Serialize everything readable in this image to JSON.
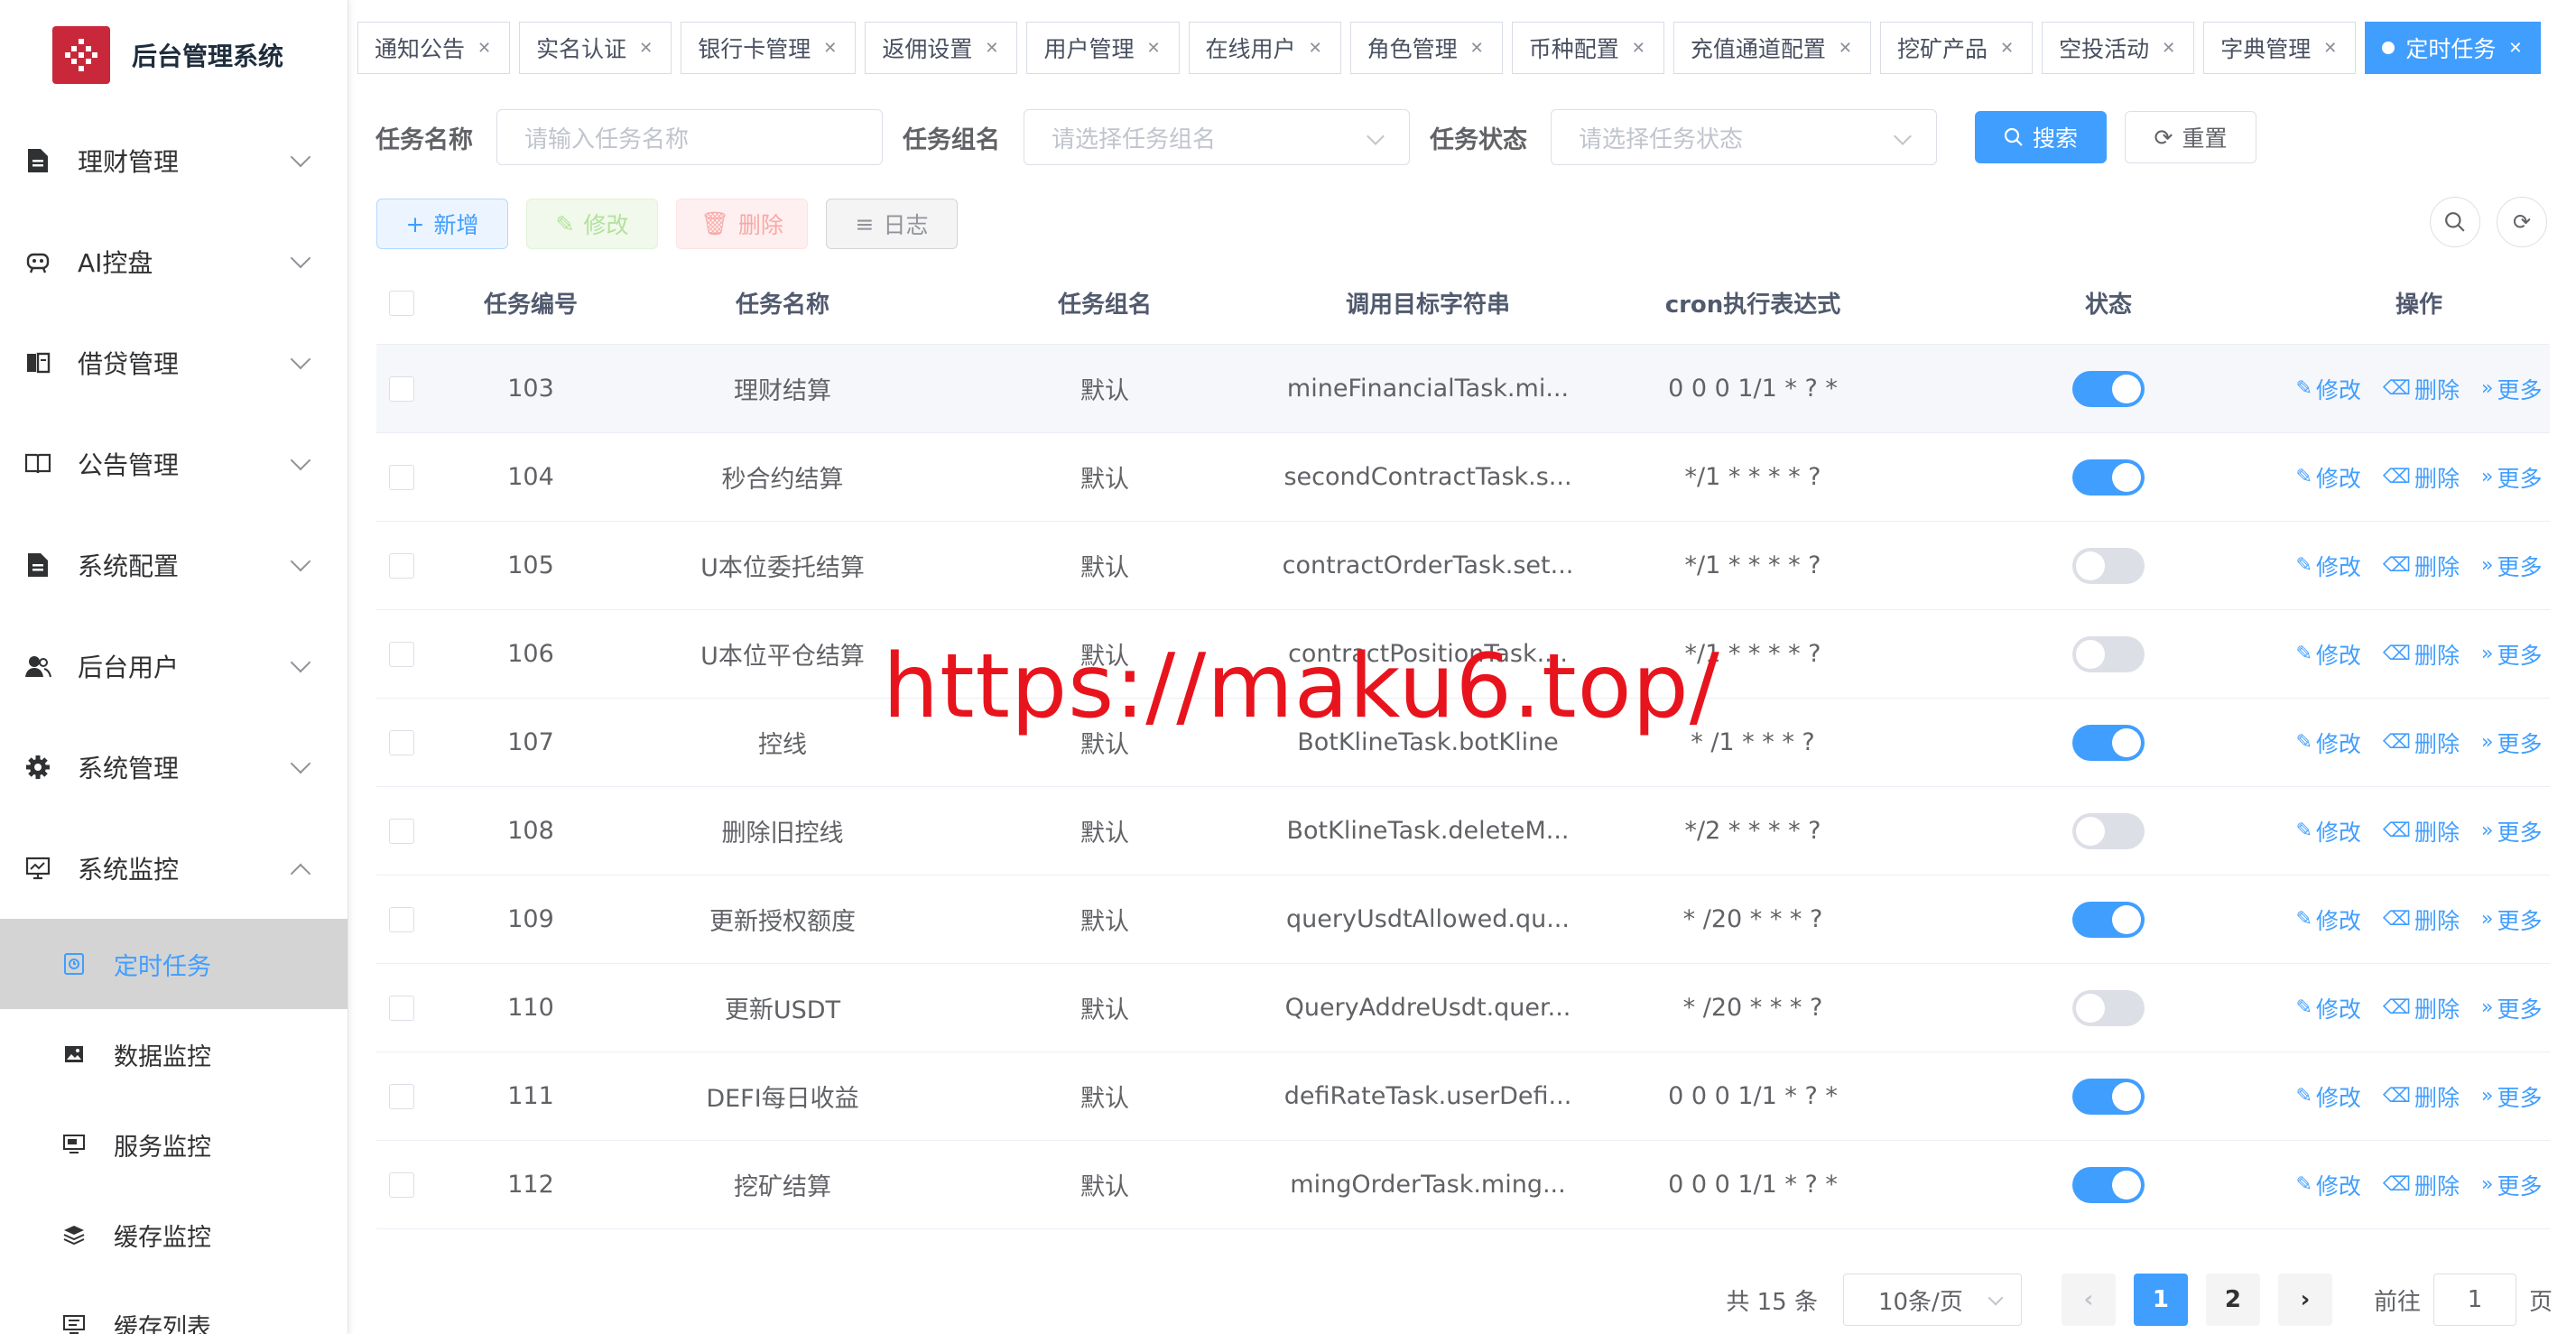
{
  "app": {
    "title": "后台管理系统"
  },
  "sidebar": {
    "menu": [
      {
        "label": "理财管理",
        "icon": "document-icon"
      },
      {
        "label": "AI控盘",
        "icon": "robot-icon"
      },
      {
        "label": "借贷管理",
        "icon": "book-icon"
      },
      {
        "label": "公告管理",
        "icon": "open-book-icon"
      },
      {
        "label": "系统配置",
        "icon": "document-icon"
      },
      {
        "label": "后台用户",
        "icon": "users-icon"
      },
      {
        "label": "系统管理",
        "icon": "gear-icon"
      },
      {
        "label": "系统监控",
        "icon": "monitor-icon"
      }
    ],
    "submenu": [
      {
        "label": "定时任务",
        "icon": "job-icon",
        "active": true
      },
      {
        "label": "数据监控",
        "icon": "image-icon"
      },
      {
        "label": "服务监控",
        "icon": "server-icon"
      },
      {
        "label": "缓存监控",
        "icon": "layers-icon"
      },
      {
        "label": "缓存列表",
        "icon": "list-monitor-icon"
      }
    ]
  },
  "tags": [
    {
      "label": "通知公告"
    },
    {
      "label": "实名认证"
    },
    {
      "label": "银行卡管理"
    },
    {
      "label": "返佣设置"
    },
    {
      "label": "用户管理"
    },
    {
      "label": "在线用户"
    },
    {
      "label": "角色管理"
    },
    {
      "label": "币种配置"
    },
    {
      "label": "充值通道配置"
    },
    {
      "label": "挖矿产品"
    },
    {
      "label": "空投活动"
    },
    {
      "label": "字典管理"
    },
    {
      "label": "定时任务",
      "active": true
    }
  ],
  "filter": {
    "job_name_label": "任务名称",
    "job_name_placeholder": "请输入任务名称",
    "job_group_label": "任务组名",
    "job_group_placeholder": "请选择任务组名",
    "status_label": "任务状态",
    "status_placeholder": "请选择任务状态",
    "search_label": "搜索",
    "reset_label": "重置"
  },
  "toolbar": {
    "add": "新增",
    "edit": "修改",
    "delete": "删除",
    "log": "日志"
  },
  "table": {
    "columns": [
      "任务编号",
      "任务名称",
      "任务组名",
      "调用目标字符串",
      "cron执行表达式",
      "状态",
      "操作"
    ],
    "ops": {
      "edit": "修改",
      "delete": "删除",
      "more": "更多"
    },
    "rows": [
      {
        "id": "103",
        "name": "理财结算",
        "group": "默认",
        "target": "mineFinancialTask.mi...",
        "cron": "0 0 0 1/1 * ? *",
        "enabled": true
      },
      {
        "id": "104",
        "name": "秒合约结算",
        "group": "默认",
        "target": "secondContractTask.s...",
        "cron": "*/1 * * * * ?",
        "enabled": true
      },
      {
        "id": "105",
        "name": "U本位委托结算",
        "group": "默认",
        "target": "contractOrderTask.set...",
        "cron": "*/1 * * * * ?",
        "enabled": false
      },
      {
        "id": "106",
        "name": "U本位平仓结算",
        "group": "默认",
        "target": "contractPositionTask....",
        "cron": "*/1 * * * * ?",
        "enabled": false
      },
      {
        "id": "107",
        "name": "控线",
        "group": "默认",
        "target": "BotKlineTask.botKline",
        "cron": "* /1 * * * ?",
        "enabled": true
      },
      {
        "id": "108",
        "name": "删除旧控线",
        "group": "默认",
        "target": "BotKlineTask.deleteM...",
        "cron": "*/2 * * * * ?",
        "enabled": false
      },
      {
        "id": "109",
        "name": "更新授权额度",
        "group": "默认",
        "target": "queryUsdtAllowed.qu...",
        "cron": "* /20 * * * ?",
        "enabled": true
      },
      {
        "id": "110",
        "name": "更新USDT",
        "group": "默认",
        "target": "QueryAddreUsdt.quer...",
        "cron": "* /20 * * * ?",
        "enabled": false
      },
      {
        "id": "111",
        "name": "DEFI每日收益",
        "group": "默认",
        "target": "defiRateTask.userDefi...",
        "cron": "0 0 0 1/1 * ? *",
        "enabled": true
      },
      {
        "id": "112",
        "name": "挖矿结算",
        "group": "默认",
        "target": "mingOrderTask.ming...",
        "cron": "0 0 0 1/1 * ? *",
        "enabled": true
      }
    ]
  },
  "pagination": {
    "total_text": "共 15 条",
    "page_size": "10条/页",
    "pages": [
      "1",
      "2"
    ],
    "current": "1",
    "goto_prefix": "前往",
    "goto_value": "1",
    "goto_suffix": "页"
  },
  "watermark": "https://maku6.top/",
  "colors": {
    "primary": "#409eff",
    "brand": "#c8283a",
    "watermark": "#e8141d"
  }
}
